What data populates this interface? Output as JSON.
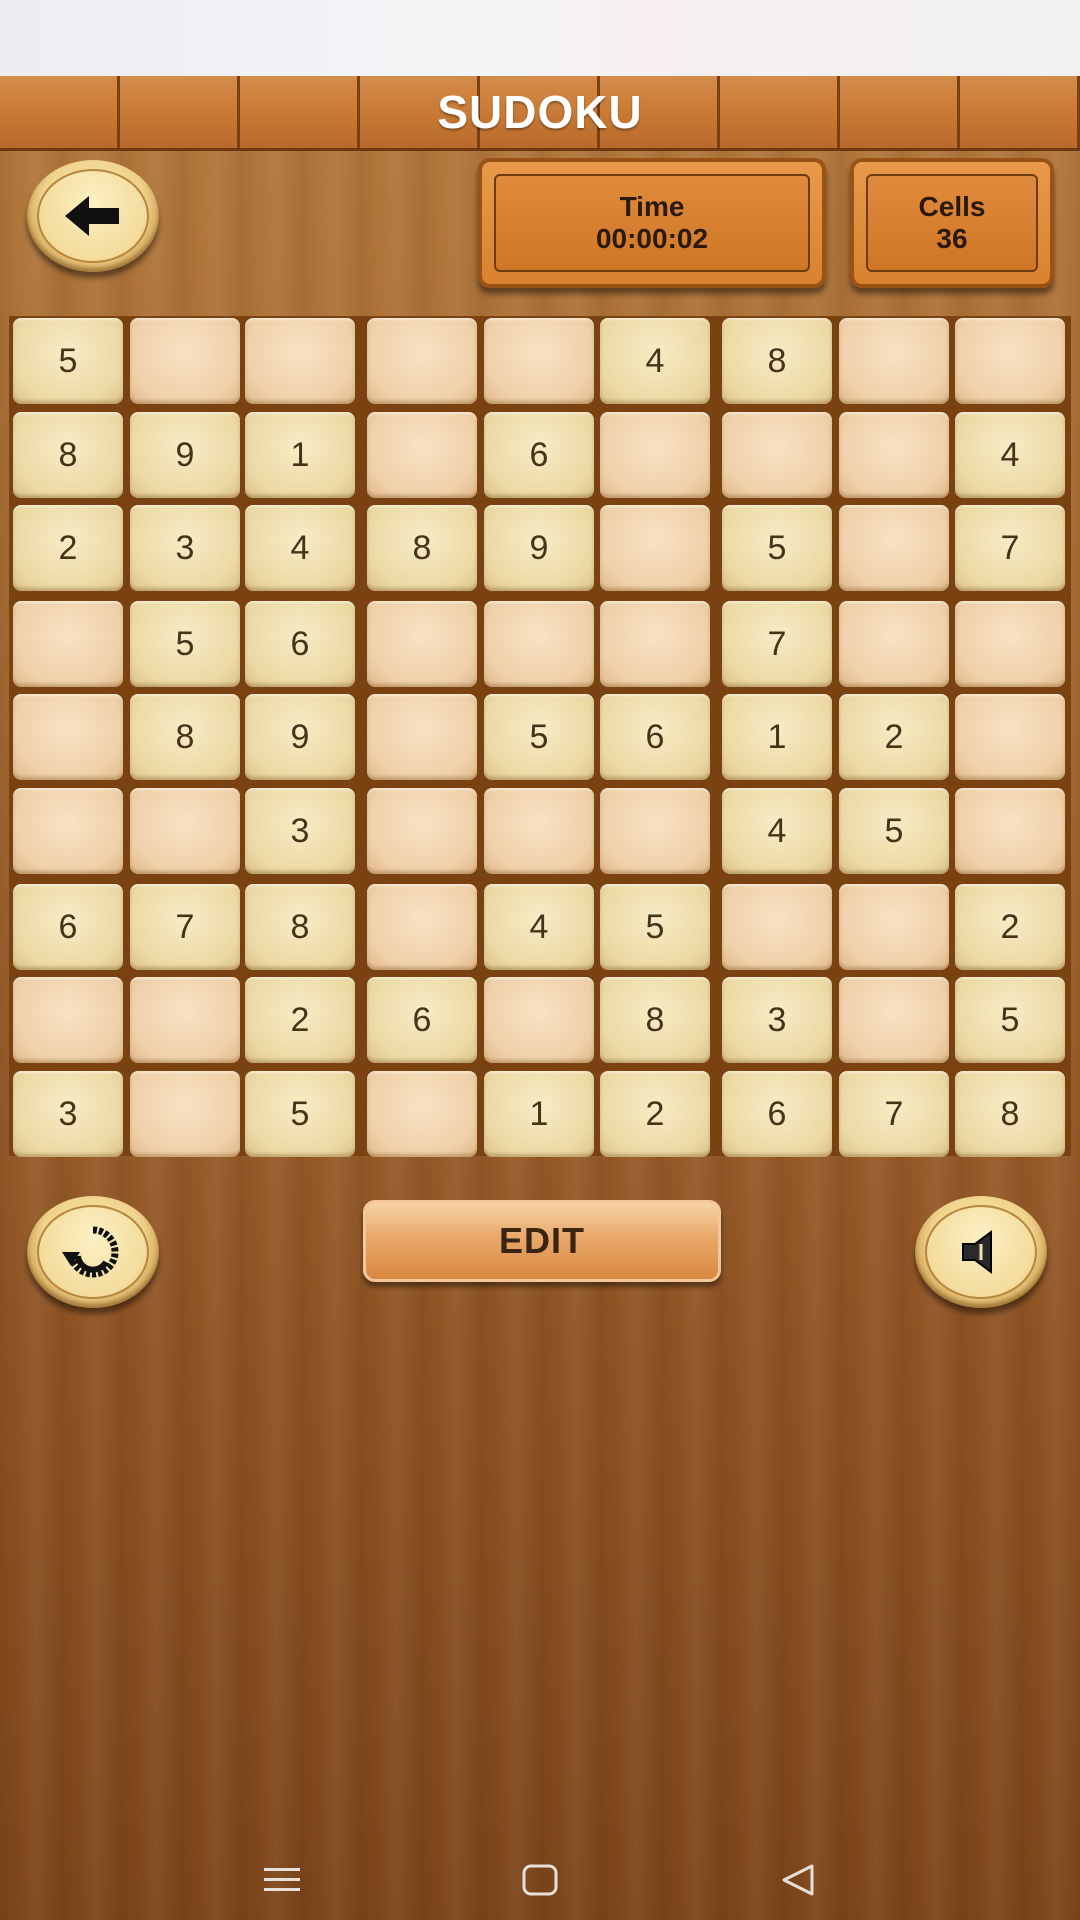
{
  "header": {
    "title": "SUDOKU"
  },
  "stats": {
    "time_label": "Time",
    "time_value": "00:00:02",
    "cells_label": "Cells",
    "cells_value": "36"
  },
  "board": {
    "rows": [
      [
        "5",
        "",
        "",
        "",
        "",
        "4",
        "8",
        "",
        ""
      ],
      [
        "8",
        "9",
        "1",
        "",
        "6",
        "",
        "",
        "",
        "4"
      ],
      [
        "2",
        "3",
        "4",
        "8",
        "9",
        "",
        "5",
        "",
        "7"
      ],
      [
        "",
        "5",
        "6",
        "",
        "",
        "",
        "7",
        "",
        ""
      ],
      [
        "",
        "8",
        "9",
        "",
        "5",
        "6",
        "1",
        "2",
        ""
      ],
      [
        "",
        "",
        "3",
        "",
        "",
        "",
        "4",
        "5",
        ""
      ],
      [
        "6",
        "7",
        "8",
        "",
        "4",
        "5",
        "",
        "",
        "2"
      ],
      [
        "",
        "",
        "2",
        "6",
        "",
        "8",
        "3",
        "",
        "5"
      ],
      [
        "3",
        "",
        "5",
        "",
        "1",
        "2",
        "6",
        "7",
        "8"
      ]
    ]
  },
  "controls": {
    "edit_label": "EDIT"
  },
  "icons": {
    "back": "arrow-left-icon",
    "restart": "restart-icon",
    "sound": "speaker-icon"
  },
  "colors": {
    "title_bar": "#c97a36",
    "board_frame": "#7a4210",
    "accent_panel": "#d9822f"
  }
}
